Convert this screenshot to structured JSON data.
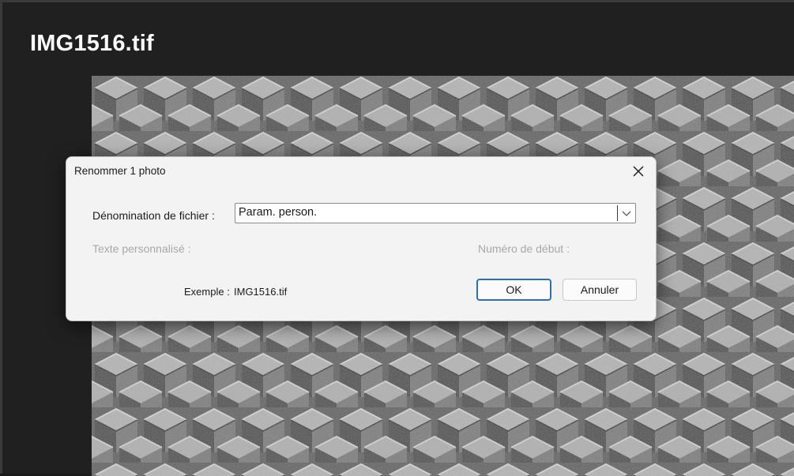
{
  "window": {
    "title": "IMG1516.tif"
  },
  "dialog": {
    "title": "Renommer 1 photo",
    "close_icon": "close-icon",
    "naming_label": "Dénomination de fichier :",
    "naming_value": "Param. person.",
    "custom_text_label": "Texte personnalisé :",
    "start_number_label": "Numéro de début :",
    "example_label": "Exemple :",
    "example_value": "IMG1516.tif",
    "ok_label": "OK",
    "cancel_label": "Annuler"
  },
  "colors": {
    "app_background": "#202020",
    "dialog_background": "#f3f3f3",
    "accent_focus": "#2a6fbf",
    "disabled_text": "#a8a8a8"
  }
}
